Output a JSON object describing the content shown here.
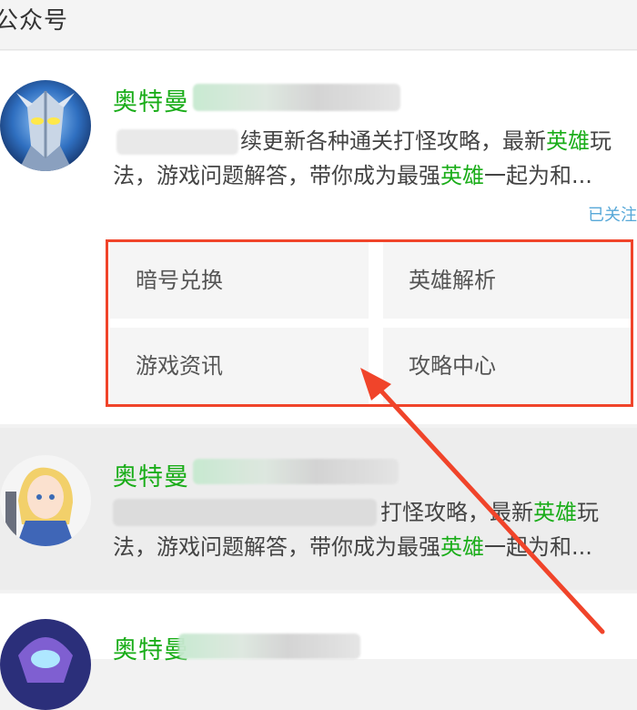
{
  "section_title": "公众号",
  "accounts": [
    {
      "name": "奥特曼",
      "desc_line1_a": "续更新各种通关打怪攻略，最新",
      "desc_line1_hl": "英雄",
      "desc_line1_b": "玩",
      "desc_line2_a": "法，游戏问题解答，带你成为最强",
      "desc_line2_hl": "英雄",
      "desc_line2_b": "一起为和...",
      "follow": "已关注",
      "menu": [
        "暗号兑换",
        "英雄解析",
        "游戏资讯",
        "攻略中心"
      ]
    },
    {
      "name": "奥特曼",
      "desc_line1_a": "打怪攻略，最新",
      "desc_line1_hl": "英雄",
      "desc_line1_b": "玩",
      "desc_line2_a": "法，游戏问题解答，带你成为最强",
      "desc_line2_hl": "英雄",
      "desc_line2_b": "一起为和..."
    },
    {
      "name": "奥特曼"
    }
  ],
  "colors": {
    "accent_green": "#1aad19",
    "annotation_red": "#f0442a",
    "follow_blue": "#57a8d8"
  }
}
